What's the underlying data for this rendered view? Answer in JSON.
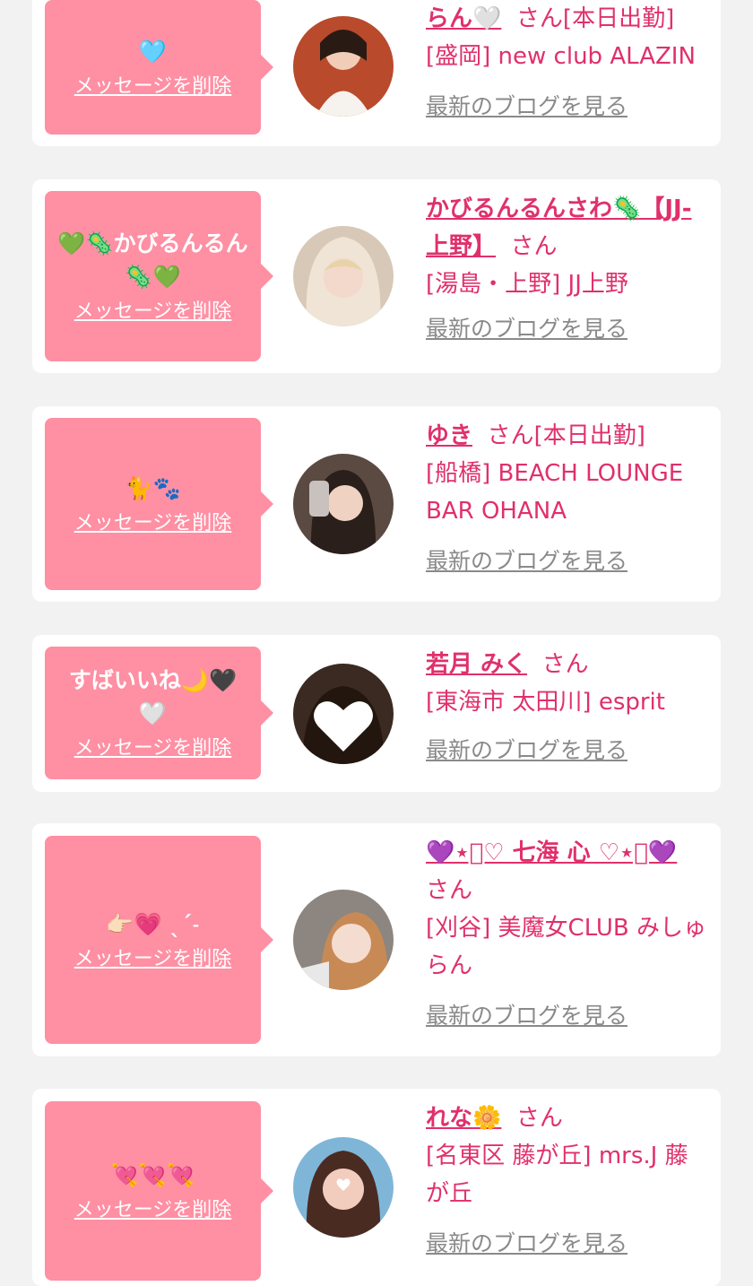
{
  "colors": {
    "bubble": "#ff8fa3",
    "accent": "#e0306b",
    "link_gray": "#8a8a8a",
    "background": "#f2f2f2"
  },
  "labels": {
    "delete": "メッセージを削除",
    "blog": "最新のブログを見る",
    "san": "さん"
  },
  "cards": [
    {
      "message": "🩵",
      "name": "らん🤍",
      "status": "[本日出勤]",
      "shop": "[盛岡] new club ALAZIN",
      "avatar_icon": "avatar-photo-icon"
    },
    {
      "message": "💚🦠かびるんるん🦠💚",
      "name": "かびるんるんさわ🦠【JJ-上野】",
      "status": "",
      "shop": "[湯島・上野] JJ上野",
      "avatar_icon": "avatar-photo-icon"
    },
    {
      "message": "🐈🐾",
      "name": "ゆき",
      "status": "[本日出勤]",
      "shop": "[船橋] BEACH LOUNGE BAR OHANA",
      "avatar_icon": "avatar-photo-icon"
    },
    {
      "message": "すばいいね🌙🖤🤍",
      "name": "若月 みく",
      "status": "",
      "shop": "[東海市 太田川] esprit",
      "avatar_icon": "avatar-heart-icon"
    },
    {
      "message": "👉🏻💗 ˎˊ˗",
      "name": "💜⋆͛♡ 七海 心 ♡⋆͛💜",
      "status": "",
      "shop": "[刈谷] 美魔女CLUB みしゅらん",
      "avatar_icon": "avatar-photo-icon"
    },
    {
      "message": "💘💘💘",
      "name": "れな🌼",
      "status": "",
      "shop": "[名東区 藤が丘] mrs.J 藤が丘",
      "avatar_icon": "avatar-photo-icon"
    }
  ]
}
